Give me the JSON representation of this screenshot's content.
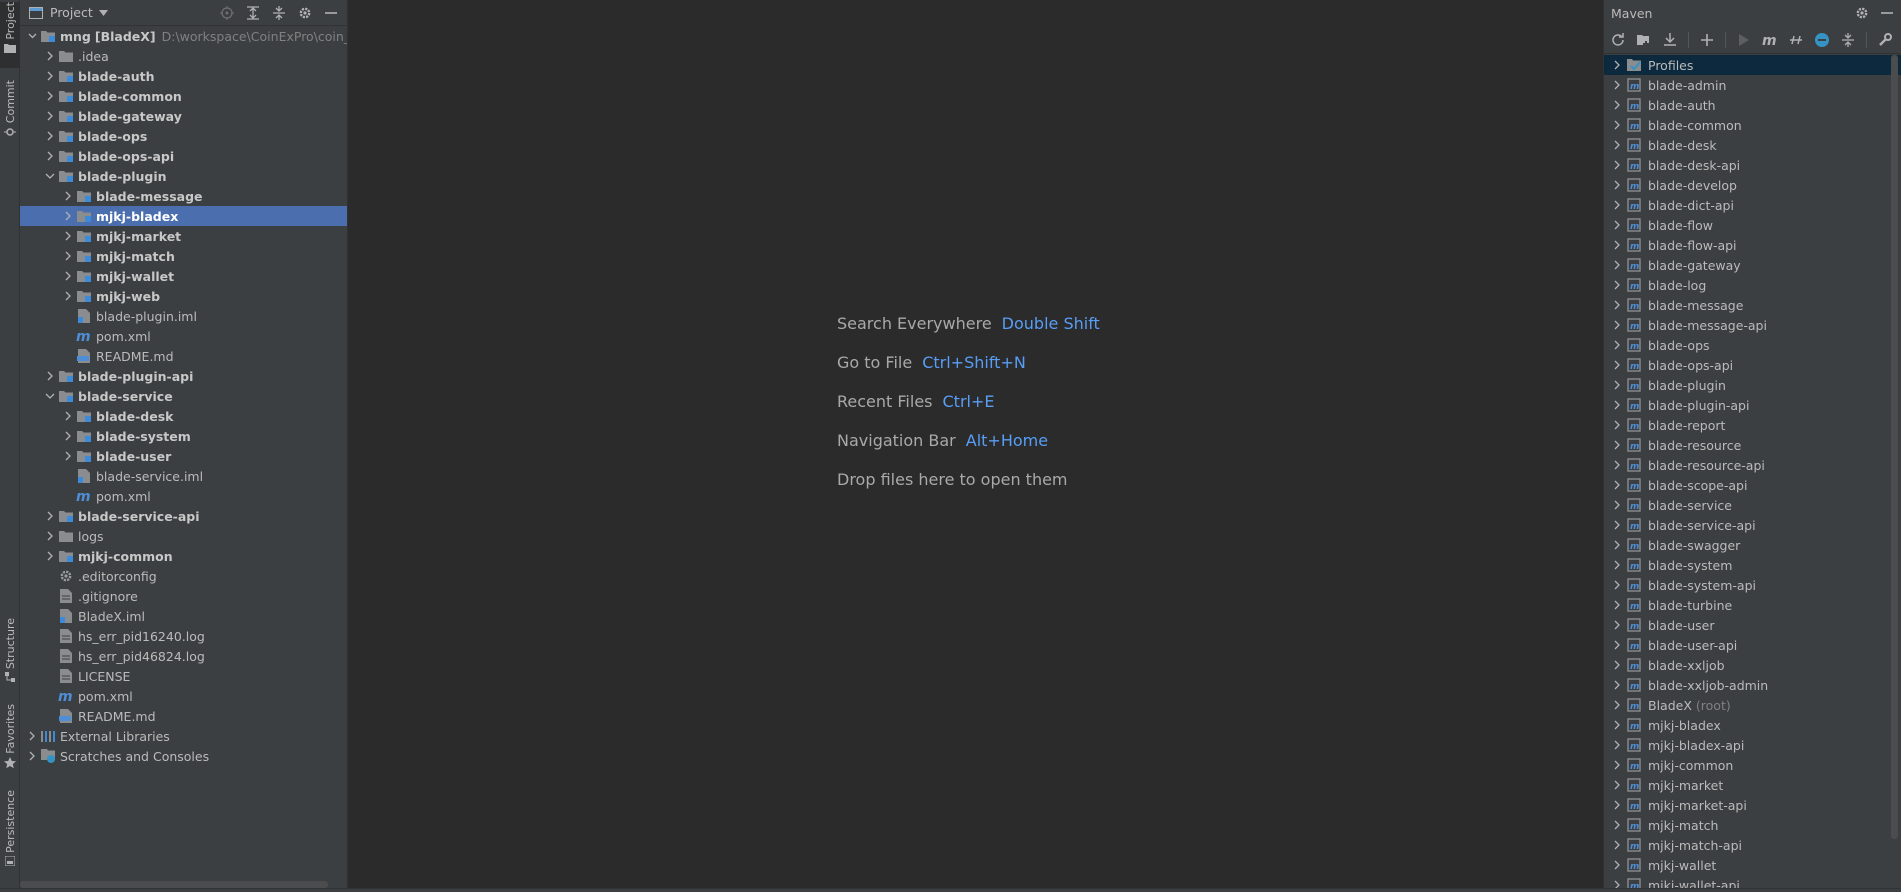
{
  "left_stripe": {
    "project_tab": "Project",
    "commit_tab": "Commit",
    "structure_tab": "Structure",
    "favorites_tab": "Favorites",
    "persistence_tab": "Persistence"
  },
  "project": {
    "title": "Project",
    "root": {
      "name": "mng",
      "module": "[BladeX]",
      "path": "D:\\workspace\\CoinExPro\\coin_mn"
    },
    "tree": [
      {
        "depth": 1,
        "arrow": "right",
        "icon": "folder",
        "label": ".idea",
        "bold": false
      },
      {
        "depth": 1,
        "arrow": "right",
        "icon": "module",
        "label": "blade-auth",
        "bold": true
      },
      {
        "depth": 1,
        "arrow": "right",
        "icon": "module",
        "label": "blade-common",
        "bold": true
      },
      {
        "depth": 1,
        "arrow": "right",
        "icon": "module",
        "label": "blade-gateway",
        "bold": true
      },
      {
        "depth": 1,
        "arrow": "right",
        "icon": "module",
        "label": "blade-ops",
        "bold": true
      },
      {
        "depth": 1,
        "arrow": "right",
        "icon": "module",
        "label": "blade-ops-api",
        "bold": true
      },
      {
        "depth": 1,
        "arrow": "down",
        "icon": "module",
        "label": "blade-plugin",
        "bold": true
      },
      {
        "depth": 2,
        "arrow": "right",
        "icon": "module",
        "label": "blade-message",
        "bold": true
      },
      {
        "depth": 2,
        "arrow": "right",
        "icon": "module",
        "label": "mjkj-bladex",
        "bold": true,
        "selected": true
      },
      {
        "depth": 2,
        "arrow": "right",
        "icon": "module",
        "label": "mjkj-market",
        "bold": true
      },
      {
        "depth": 2,
        "arrow": "right",
        "icon": "module",
        "label": "mjkj-match",
        "bold": true
      },
      {
        "depth": 2,
        "arrow": "right",
        "icon": "module",
        "label": "mjkj-wallet",
        "bold": true
      },
      {
        "depth": 2,
        "arrow": "right",
        "icon": "module",
        "label": "mjkj-web",
        "bold": true
      },
      {
        "depth": 2,
        "arrow": "none",
        "icon": "iml",
        "label": "blade-plugin.iml",
        "bold": false
      },
      {
        "depth": 2,
        "arrow": "none",
        "icon": "maven",
        "label": "pom.xml",
        "bold": false
      },
      {
        "depth": 2,
        "arrow": "none",
        "icon": "md",
        "label": "README.md",
        "bold": false
      },
      {
        "depth": 1,
        "arrow": "right",
        "icon": "module",
        "label": "blade-plugin-api",
        "bold": true
      },
      {
        "depth": 1,
        "arrow": "down",
        "icon": "module",
        "label": "blade-service",
        "bold": true
      },
      {
        "depth": 2,
        "arrow": "right",
        "icon": "module",
        "label": "blade-desk",
        "bold": true
      },
      {
        "depth": 2,
        "arrow": "right",
        "icon": "module",
        "label": "blade-system",
        "bold": true
      },
      {
        "depth": 2,
        "arrow": "right",
        "icon": "module",
        "label": "blade-user",
        "bold": true
      },
      {
        "depth": 2,
        "arrow": "none",
        "icon": "iml",
        "label": "blade-service.iml",
        "bold": false
      },
      {
        "depth": 2,
        "arrow": "none",
        "icon": "maven",
        "label": "pom.xml",
        "bold": false
      },
      {
        "depth": 1,
        "arrow": "right",
        "icon": "module",
        "label": "blade-service-api",
        "bold": true
      },
      {
        "depth": 1,
        "arrow": "right",
        "icon": "folder",
        "label": "logs",
        "bold": false
      },
      {
        "depth": 1,
        "arrow": "right",
        "icon": "module",
        "label": "mjkj-common",
        "bold": true
      },
      {
        "depth": 1,
        "arrow": "none",
        "icon": "gear",
        "label": ".editorconfig",
        "bold": false
      },
      {
        "depth": 1,
        "arrow": "none",
        "icon": "file",
        "label": ".gitignore",
        "bold": false
      },
      {
        "depth": 1,
        "arrow": "none",
        "icon": "iml",
        "label": "BladeX.iml",
        "bold": false
      },
      {
        "depth": 1,
        "arrow": "none",
        "icon": "file",
        "label": "hs_err_pid16240.log",
        "bold": false
      },
      {
        "depth": 1,
        "arrow": "none",
        "icon": "file",
        "label": "hs_err_pid46824.log",
        "bold": false
      },
      {
        "depth": 1,
        "arrow": "none",
        "icon": "file",
        "label": "LICENSE",
        "bold": false
      },
      {
        "depth": 1,
        "arrow": "none",
        "icon": "maven",
        "label": "pom.xml",
        "bold": false
      },
      {
        "depth": 1,
        "arrow": "none",
        "icon": "md",
        "label": "README.md",
        "bold": false
      },
      {
        "depth": 0,
        "arrow": "right",
        "icon": "libs",
        "label": "External Libraries",
        "bold": false
      },
      {
        "depth": 0,
        "arrow": "right",
        "icon": "scratch",
        "label": "Scratches and Consoles",
        "bold": false
      }
    ]
  },
  "editor": {
    "hints": [
      {
        "action": "Search Everywhere",
        "shortcut": "Double Shift"
      },
      {
        "action": "Go to File",
        "shortcut": "Ctrl+Shift+N"
      },
      {
        "action": "Recent Files",
        "shortcut": "Ctrl+E"
      },
      {
        "action": "Navigation Bar",
        "shortcut": "Alt+Home"
      },
      {
        "action": "Drop files here to open them",
        "shortcut": ""
      }
    ]
  },
  "maven": {
    "title": "Maven",
    "items": [
      {
        "label": "Profiles",
        "icon": "profiles",
        "selected": true
      },
      {
        "label": "blade-admin"
      },
      {
        "label": "blade-auth"
      },
      {
        "label": "blade-common"
      },
      {
        "label": "blade-desk"
      },
      {
        "label": "blade-desk-api"
      },
      {
        "label": "blade-develop"
      },
      {
        "label": "blade-dict-api"
      },
      {
        "label": "blade-flow"
      },
      {
        "label": "blade-flow-api"
      },
      {
        "label": "blade-gateway"
      },
      {
        "label": "blade-log"
      },
      {
        "label": "blade-message"
      },
      {
        "label": "blade-message-api"
      },
      {
        "label": "blade-ops"
      },
      {
        "label": "blade-ops-api"
      },
      {
        "label": "blade-plugin"
      },
      {
        "label": "blade-plugin-api"
      },
      {
        "label": "blade-report"
      },
      {
        "label": "blade-resource"
      },
      {
        "label": "blade-resource-api"
      },
      {
        "label": "blade-scope-api"
      },
      {
        "label": "blade-service"
      },
      {
        "label": "blade-service-api"
      },
      {
        "label": "blade-swagger"
      },
      {
        "label": "blade-system"
      },
      {
        "label": "blade-system-api"
      },
      {
        "label": "blade-turbine"
      },
      {
        "label": "blade-user"
      },
      {
        "label": "blade-user-api"
      },
      {
        "label": "blade-xxljob"
      },
      {
        "label": "blade-xxljob-admin"
      },
      {
        "label": "BladeX",
        "suffix": "(root)"
      },
      {
        "label": "mjkj-bladex"
      },
      {
        "label": "mjkj-bladex-api"
      },
      {
        "label": "mjkj-common"
      },
      {
        "label": "mjkj-market"
      },
      {
        "label": "mjkj-market-api"
      },
      {
        "label": "mjkj-match"
      },
      {
        "label": "mjkj-match-api"
      },
      {
        "label": "mjkj-wallet"
      },
      {
        "label": "mjkj-wallet-api"
      }
    ]
  },
  "colors": {
    "accent": "#589df6",
    "selection": "#4b6eaf",
    "panel": "#3c3f41",
    "editor": "#2b2b2b"
  }
}
